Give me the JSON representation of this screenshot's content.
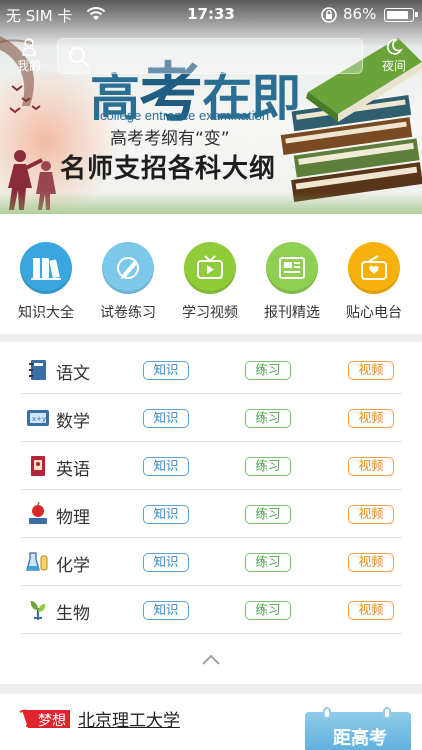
{
  "status_bar": {
    "carrier": "无 SIM 卡",
    "time": "17:33",
    "battery_pct": "86%",
    "battery_level": 0.86
  },
  "nav": {
    "me_label": "我的",
    "night_label": "夜间",
    "search_placeholder": ""
  },
  "banner": {
    "title_1": "高",
    "title_2": "考",
    "title_3": "在即",
    "subtitle_en": "college entrance examination",
    "line2": "高考考纲有“变”",
    "line3": "名师支招各科大纲"
  },
  "quick_links": [
    {
      "label": "知识大全",
      "icon": "books-icon",
      "color": "#3aa6e0"
    },
    {
      "label": "试卷练习",
      "icon": "pencil-paper-icon",
      "color": "#7cc8ea"
    },
    {
      "label": "学习视频",
      "icon": "tv-icon",
      "color": "#8ecc3a"
    },
    {
      "label": "报刊精选",
      "icon": "newspaper-icon",
      "color": "#8fcf52"
    },
    {
      "label": "贴心电台",
      "icon": "radio-icon",
      "color": "#f6b10e"
    }
  ],
  "subjects": {
    "tag_knowledge": "知识",
    "tag_practice": "练习",
    "tag_video": "视频",
    "items": [
      {
        "name": "语文",
        "icon": "notebook-icon"
      },
      {
        "name": "数学",
        "icon": "calculator-icon"
      },
      {
        "name": "英语",
        "icon": "book-icon"
      },
      {
        "name": "物理",
        "icon": "apple-icon"
      },
      {
        "name": "化学",
        "icon": "flask-icon"
      },
      {
        "name": "生物",
        "icon": "leaf-icon"
      }
    ]
  },
  "bottom": {
    "dream_label": "梦想",
    "university": "北京理工大学",
    "countdown_label": "距高考"
  }
}
